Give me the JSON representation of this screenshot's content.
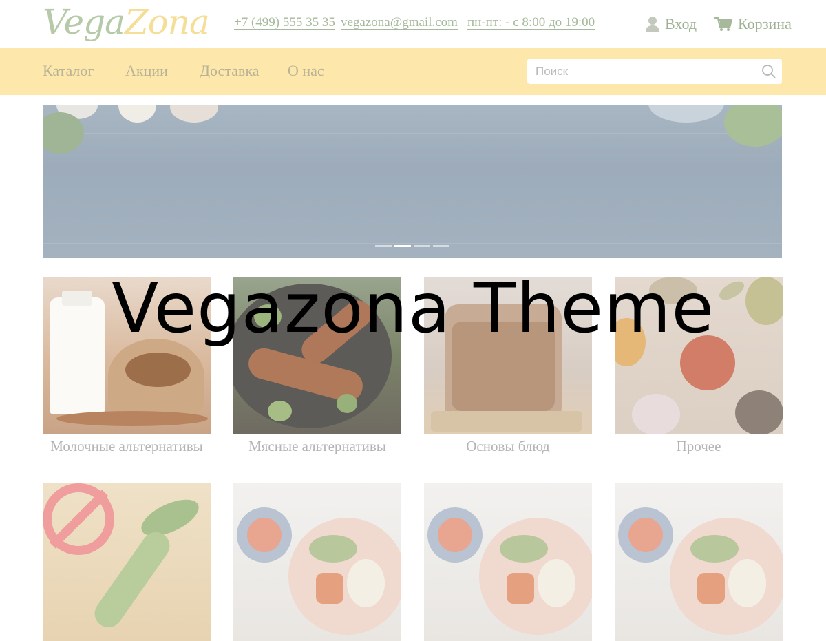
{
  "header": {
    "logo_part1": "Vega",
    "logo_part2": "Zona",
    "phone": "+7 (499) 555 35 35",
    "email": "vegazona@gmail.com",
    "hours": "пн-пт: - с 8:00 до 19:00",
    "login_label": "Вход",
    "cart_label": "Корзина",
    "login_icon": "user-icon",
    "cart_icon": "cart-icon"
  },
  "nav": {
    "items": [
      {
        "label": "Каталог"
      },
      {
        "label": "Акции"
      },
      {
        "label": "Доставка"
      },
      {
        "label": "О нас"
      }
    ],
    "search_placeholder": "Поиск",
    "search_icon": "search-icon"
  },
  "banner": {
    "slides_count": 4,
    "active_slide": 2
  },
  "categories": [
    {
      "label": "Молочные альтернативы"
    },
    {
      "label": "Мясные альтернативы"
    },
    {
      "label": "Основы блюд"
    },
    {
      "label": "Прочее"
    },
    {
      "label": ""
    },
    {
      "label": ""
    },
    {
      "label": ""
    },
    {
      "label": ""
    }
  ],
  "overlay_title": "Vegazona Theme",
  "colors": {
    "nav_bg": "#fde7aa",
    "logo_green": "#b6c9a8",
    "logo_yellow": "#f5de97",
    "link_green": "#a7b99c"
  }
}
